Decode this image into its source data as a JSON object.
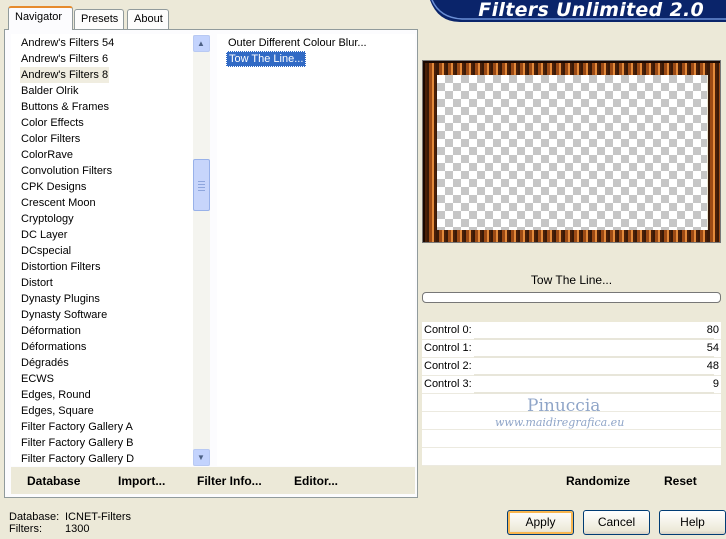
{
  "app": {
    "title": "Filters Unlimited 2.0"
  },
  "tabs": [
    {
      "label": "Navigator",
      "active": true
    },
    {
      "label": "Presets",
      "active": false
    },
    {
      "label": "About",
      "active": false
    }
  ],
  "categories": [
    "Andrew's Filters 54",
    "Andrew's Filters 6",
    "Andrew's Filters 8",
    "Balder Olrik",
    "Buttons & Frames",
    "Color Effects",
    "Color Filters",
    "ColorRave",
    "Convolution Filters",
    "CPK Designs",
    "Crescent Moon",
    "Cryptology",
    "DC Layer",
    "DCspecial",
    "Distortion Filters",
    "Distort",
    "Dynasty Plugins",
    "Dynasty Software",
    "Déformation",
    "Déformations",
    "Dégradés",
    "ECWS",
    "Edges, Round",
    "Edges, Square",
    "Filter Factory Gallery A",
    "Filter Factory Gallery B",
    "Filter Factory Gallery D"
  ],
  "selected_category": "Andrew's Filters 8",
  "filters": [
    "Outer Different Colour Blur...",
    "Tow The Line..."
  ],
  "selected_filter": "Tow The Line...",
  "left_buttons": {
    "database": "Database",
    "import": "Import...",
    "filter_info": "Filter Info...",
    "editor": "Editor..."
  },
  "effect_name": "Tow The Line...",
  "controls": [
    {
      "label": "Control 0:",
      "value": "80"
    },
    {
      "label": "Control 1:",
      "value": "54"
    },
    {
      "label": "Control 2:",
      "value": "48"
    },
    {
      "label": "Control 3:",
      "value": "9"
    }
  ],
  "watermark": {
    "line1": "Pinuccia",
    "line2": "www.maidiregrafica.eu"
  },
  "right_buttons": {
    "randomize": "Randomize",
    "reset": "Reset"
  },
  "status": {
    "database_key": "Database:",
    "database_value": "ICNET-Filters",
    "filters_key": "Filters:",
    "filters_value": "1300"
  },
  "dialog_buttons": {
    "apply": "Apply",
    "cancel": "Cancel",
    "help": "Help"
  },
  "colors": {
    "banner": "#0a246a",
    "selection": "#316ac5",
    "frame": "#9b4a15"
  }
}
